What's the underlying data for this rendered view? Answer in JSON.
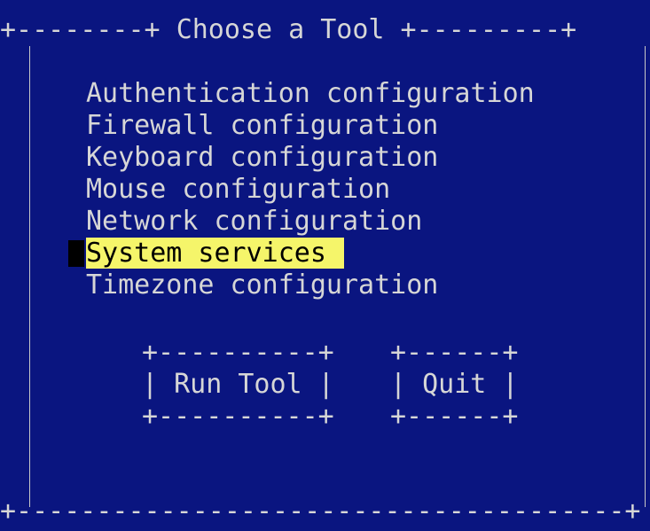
{
  "dialog": {
    "title": "Choose a Tool"
  },
  "menu": {
    "items": [
      {
        "label": "Authentication configuration",
        "selected": false
      },
      {
        "label": "Firewall configuration",
        "selected": false
      },
      {
        "label": "Keyboard configuration",
        "selected": false
      },
      {
        "label": "Mouse configuration",
        "selected": false
      },
      {
        "label": "Network configuration",
        "selected": false
      },
      {
        "label": "System services",
        "selected": true
      },
      {
        "label": "Timezone configuration",
        "selected": false
      }
    ]
  },
  "buttons": {
    "run_label": "Run Tool",
    "quit_label": "Quit"
  },
  "colors": {
    "background": "#0a1580",
    "text": "#d6d6d6",
    "highlight": "#f5f56a",
    "highlight_text": "#000000"
  }
}
